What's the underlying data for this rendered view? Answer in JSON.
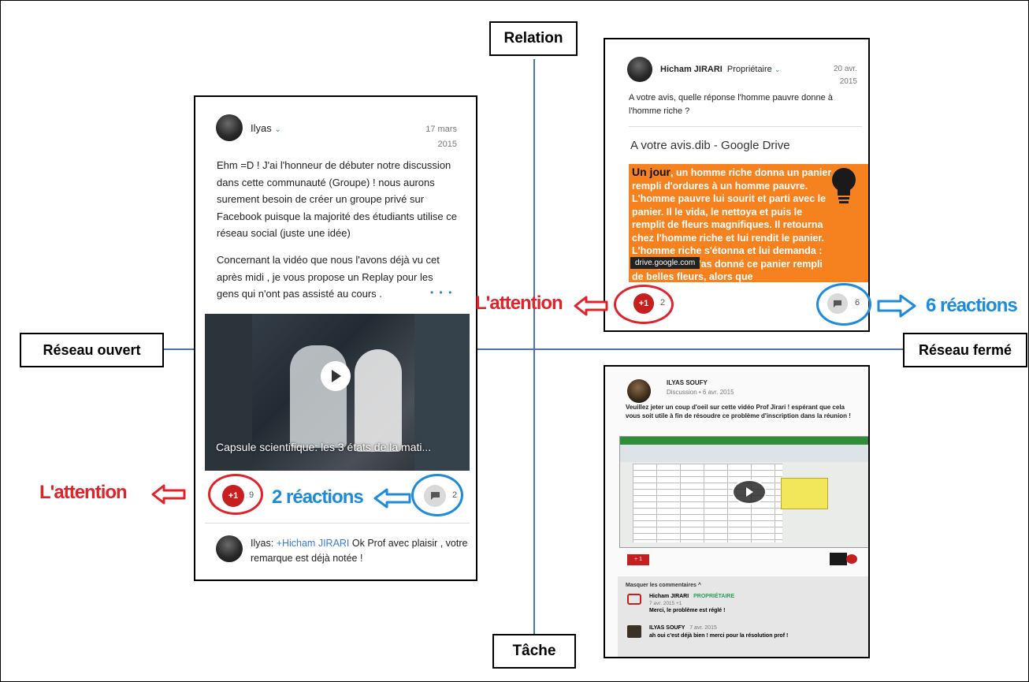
{
  "axes": {
    "top": "Relation",
    "bottom": "Tâche",
    "left": "Réseau ouvert",
    "right": "Réseau fermé"
  },
  "post_left": {
    "author": "Ilyas",
    "date": "17 mars\n2015",
    "paragraph1": "Ehm =D ! J'ai l'honneur de débuter notre discussion dans cette communauté (Groupe) ! nous aurons surement besoin de créer un groupe privé sur Facebook puisque la majorité des étudiants utilise ce réseau social (juste une idée)",
    "paragraph2": "Concernant la vidéo que nous l'avons déjà vu cet après midi , je vous propose un Replay pour les gens qui n'ont pas assisté au cours .",
    "more": "• • •",
    "video_caption": "Capsule scientifique: les 3 états de la mati...",
    "plus_label": "+1",
    "plus_count": "9",
    "comment_count": "2",
    "comment_author": "Ilyas:",
    "comment_mention": "+Hicham JIRARI",
    "comment_text": "Ok Prof avec plaisir , votre remarque est déjà notée !"
  },
  "post_top_right": {
    "author": "Hicham JIRARI",
    "role": "Propriétaire",
    "date": "20 avr.\n2015",
    "text": "A votre avis, quelle réponse l'homme pauvre donne à l'homme riche ?",
    "link_title": "A votre avis.dib - Google Drive",
    "orange_lead": "Un jour",
    "orange_text": ", un homme riche donna un panier rempli d'ordures à un homme pauvre. L'homme pauvre lui sourit et parti avec le panier. Il le vida, le nettoya et puis le remplit de fleurs magnifiques. Il retourna chez l'homme riche et lui rendit le panier. L'homme riche s'étonna et lui demanda : Pourquoi tu m'as donné ce panier rempli de belles fleurs, alors que",
    "domain_badge": "drive.google.com",
    "plus_label": "+1",
    "plus_count": "2",
    "comment_count": "6"
  },
  "post_bottom_right": {
    "author": "ILYAS SOUFY",
    "subline": "Discussion  •  6 avr. 2015",
    "text": "Veuillez jeter un coup d'oeil sur cette vidéo Prof Jirari ! espérant que cela vous soit utile à fin de résoudre ce problème d'inscription dans la réunion !",
    "plus_label": "+ 1",
    "hide_comments": "Masquer les commentaires  ^",
    "c1_author": "Hicham JIRARI",
    "c1_role": "PROPRIÉTAIRE",
    "c1_date": "7 avr. 2015  +1",
    "c1_text": "Merci, le problème est réglé !",
    "c2_author": "ILYAS SOUFY",
    "c2_date": "7 avr. 2015",
    "c2_text": "ah oui c'est déjà bien ! merci pour la résolution prof !"
  },
  "annotations": {
    "attention_left": "L'attention",
    "reactions_left": "2 réactions",
    "attention_right": "L'attention",
    "reactions_right": "6 réactions"
  },
  "colors": {
    "axis": "#4a74b0",
    "annotation_red": "#e0232b",
    "annotation_blue": "#1e8bd8",
    "orange": "#f5821f"
  }
}
